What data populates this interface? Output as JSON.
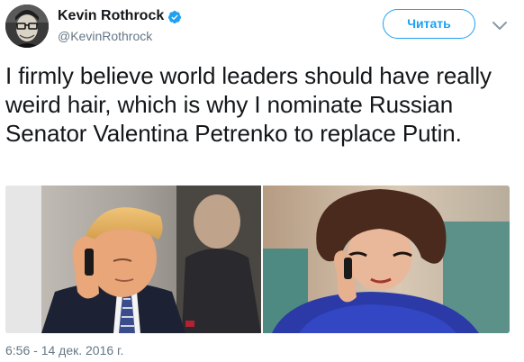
{
  "author": {
    "name": "Kevin Rothrock",
    "handle": "@KevinRothrock",
    "verified": true
  },
  "actions": {
    "follow_label": "Читать",
    "menu_icon": "chevron-down-icon"
  },
  "tweet": {
    "text": "I firmly believe world leaders should have really weird hair, which is why I nominate Russian Senator Valentina Petrenko to replace Putin.",
    "timestamp": "6:56 - 14 дек. 2016 г."
  },
  "media": {
    "photo_count": 2
  },
  "colors": {
    "accent": "#1da1f2",
    "text": "#14171a",
    "secondary_text": "#657786"
  }
}
